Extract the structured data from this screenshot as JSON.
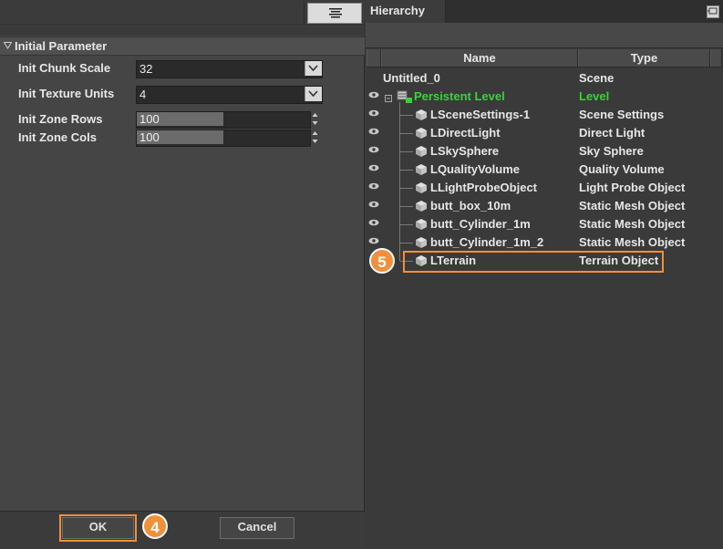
{
  "left_panel": {
    "section_title": "Initial Parameter",
    "params": [
      {
        "label": "Init Chunk Scale",
        "value": "32",
        "kind": "combo"
      },
      {
        "label": "Init Texture Units",
        "value": "4",
        "kind": "combo"
      },
      {
        "label": "Init Zone Rows",
        "value": "100",
        "kind": "spin"
      },
      {
        "label": "Init Zone Cols",
        "value": "100",
        "kind": "spin"
      }
    ],
    "ok_label": "OK",
    "cancel_label": "Cancel",
    "ok_step": "4"
  },
  "hierarchy": {
    "tab_title": "Hierarchy",
    "columns": {
      "name": "Name",
      "type": "Type"
    },
    "root": {
      "name": "Untitled_0",
      "type": "Scene"
    },
    "level": {
      "name": "Persistent Level",
      "type": "Level",
      "color": "#3ad13a"
    },
    "items": [
      {
        "name": "LSceneSettings-1",
        "type": "Scene Settings"
      },
      {
        "name": "LDirectLight",
        "type": "Direct Light"
      },
      {
        "name": "LSkySphere",
        "type": "Sky Sphere"
      },
      {
        "name": "LQualityVolume",
        "type": "Quality Volume"
      },
      {
        "name": "LLightProbeObject",
        "type": "Light Probe Object"
      },
      {
        "name": "butt_box_10m",
        "type": "Static Mesh Object"
      },
      {
        "name": "butt_Cylinder_1m",
        "type": "Static Mesh Object"
      },
      {
        "name": "butt_Cylinder_1m_2",
        "type": "Static Mesh Object"
      },
      {
        "name": "LTerrain",
        "type": "Terrain Object"
      }
    ],
    "highlight_step": "5"
  },
  "colors": {
    "accent": "#f0903a",
    "level_green": "#3ad13a"
  }
}
